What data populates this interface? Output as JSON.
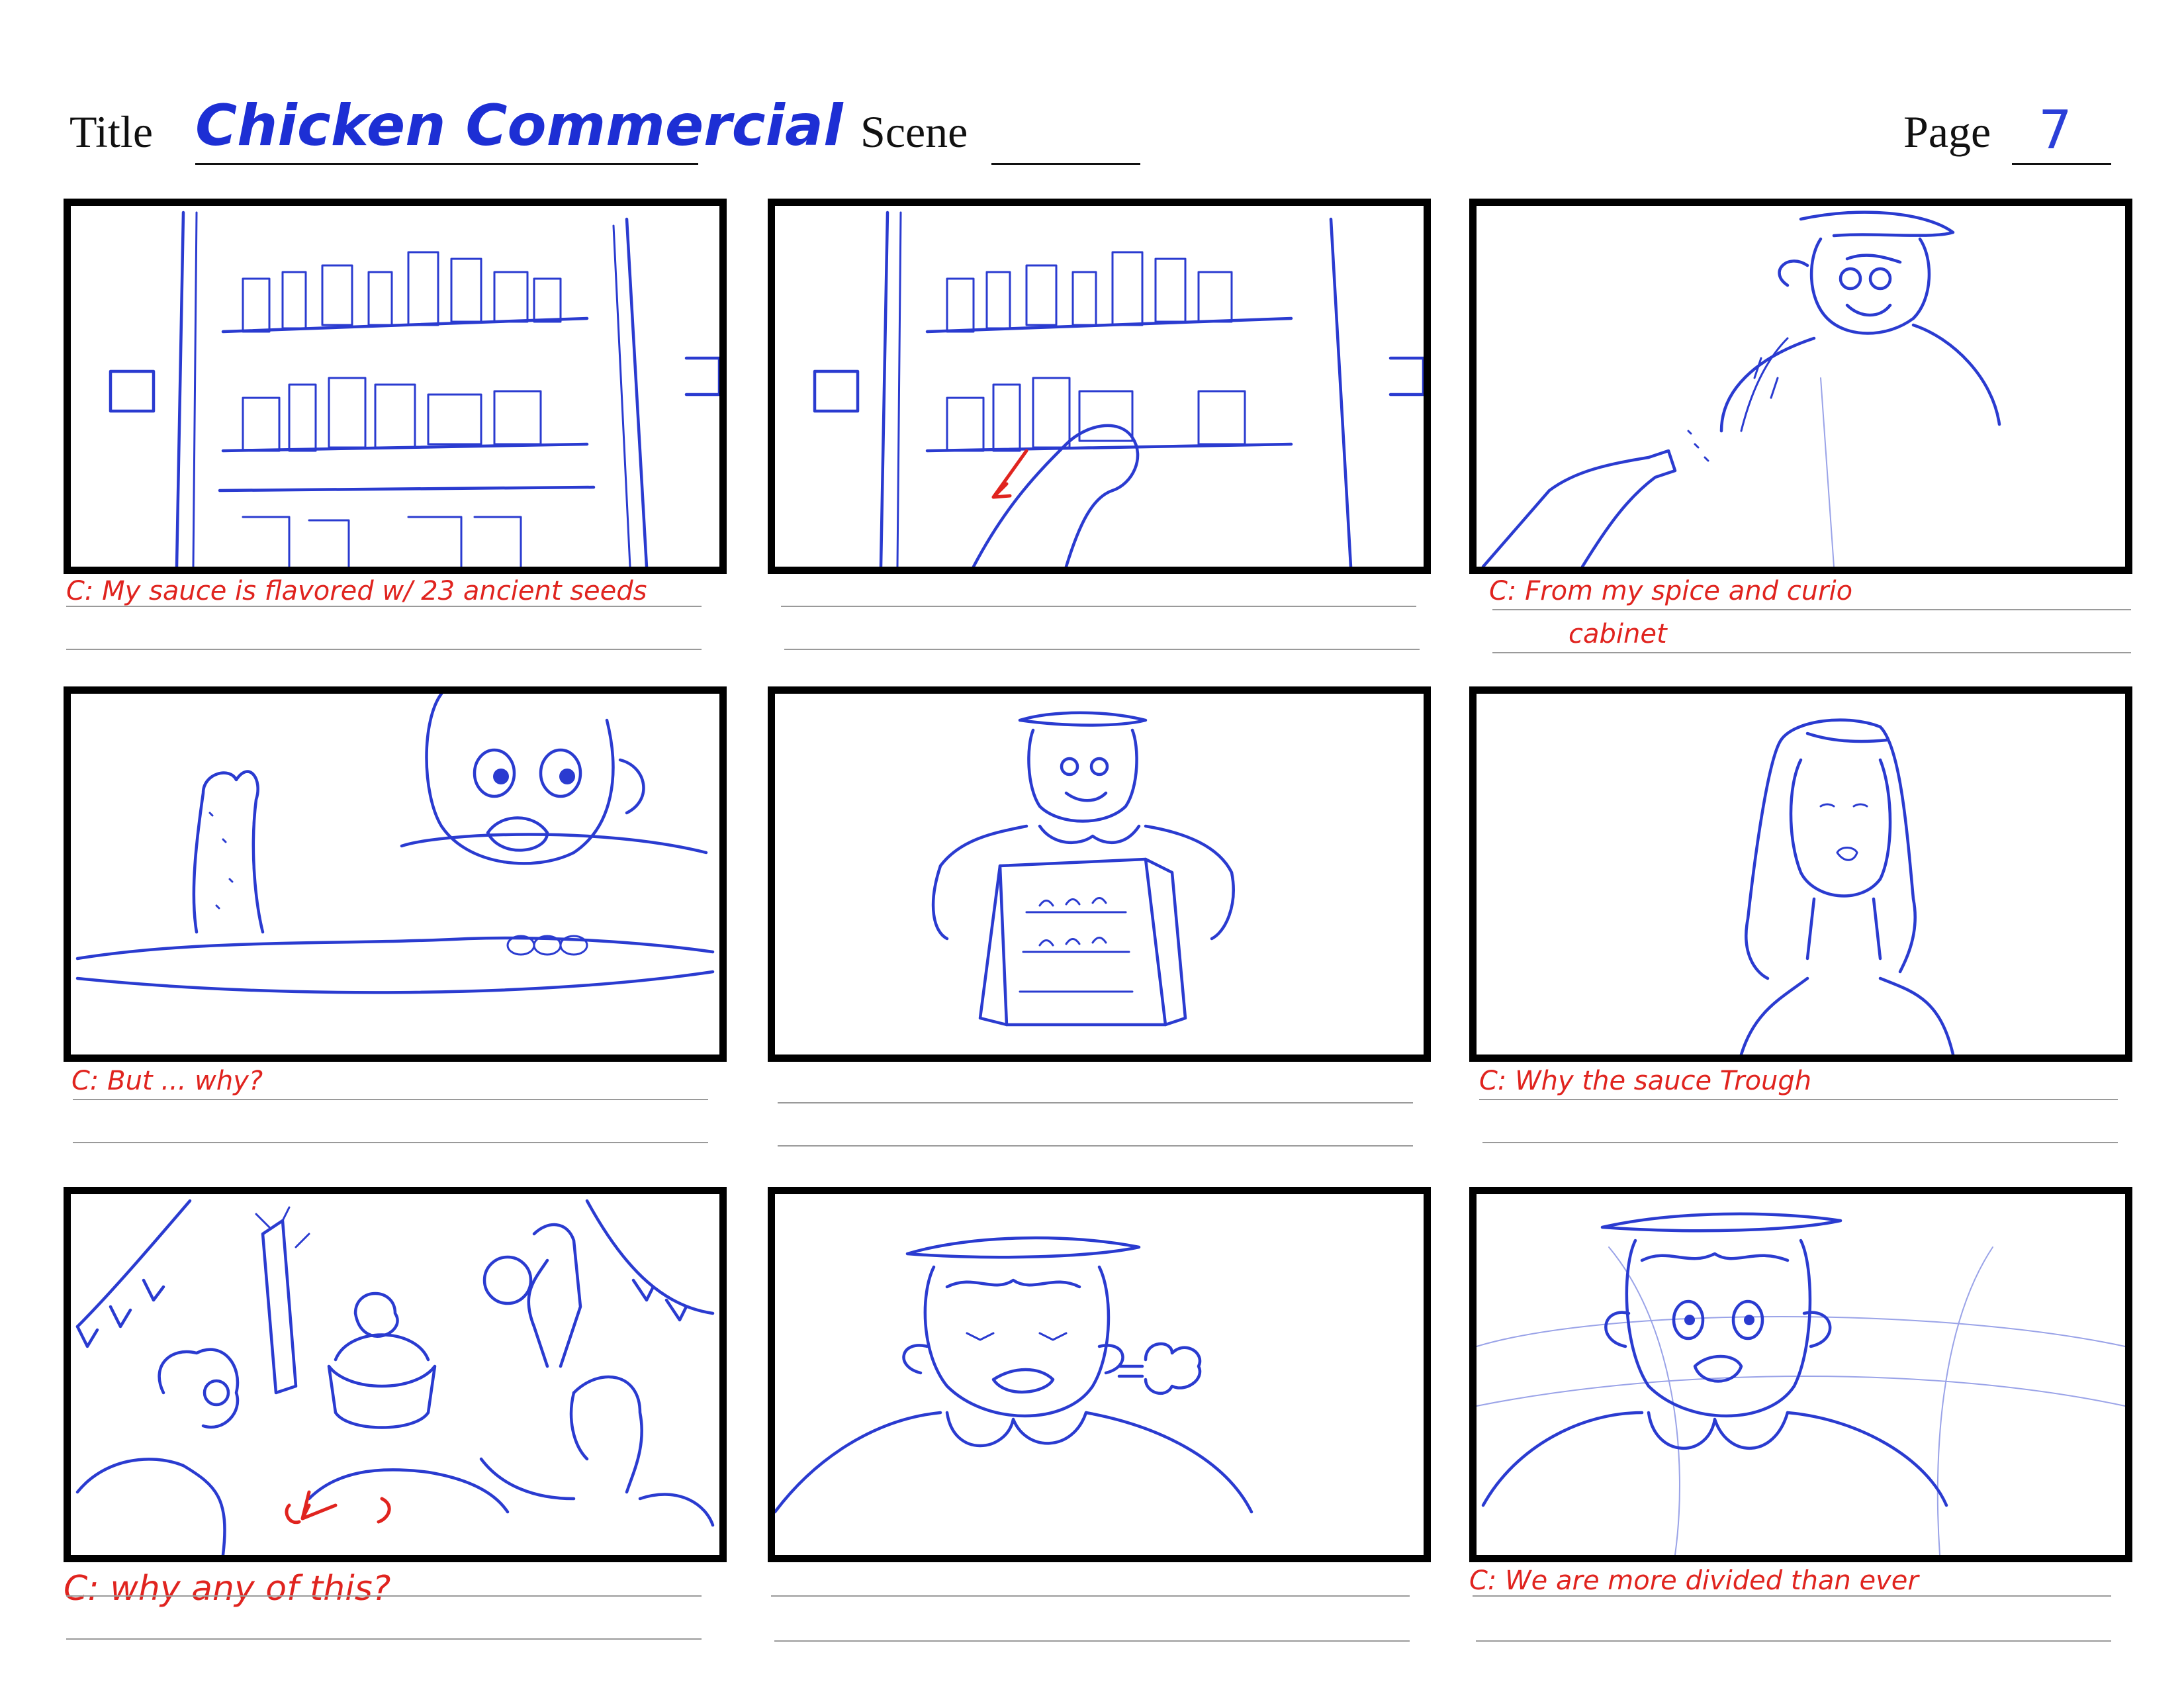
{
  "header": {
    "title_label": "Title",
    "title_value": "Chicken Commercial",
    "scene_label": "Scene",
    "scene_value": "",
    "page_label": "Page",
    "page_value": "7"
  },
  "panels": [
    {
      "id": 1,
      "caption": "C: My sauce is flavored w/ 23 ancient seeds",
      "caption2": ""
    },
    {
      "id": 2,
      "caption": "",
      "caption2": ""
    },
    {
      "id": 3,
      "caption": "C: From my spice and curio",
      "caption2": "cabinet"
    },
    {
      "id": 4,
      "caption": "C: But ... why?",
      "caption2": ""
    },
    {
      "id": 5,
      "caption": "",
      "caption2": ""
    },
    {
      "id": 6,
      "caption": "C: Why the sauce Trough",
      "caption2": ""
    },
    {
      "id": 7,
      "caption": "C: why any of this?",
      "caption2": ""
    },
    {
      "id": 8,
      "caption": "",
      "caption2": ""
    },
    {
      "id": 9,
      "caption": "C: We are more divided than ever",
      "caption2": ""
    }
  ],
  "colors": {
    "sketch": "#2a3bd0",
    "caption": "#e0241f",
    "title_ink": "#1d2fd4",
    "frame": "#000000"
  }
}
